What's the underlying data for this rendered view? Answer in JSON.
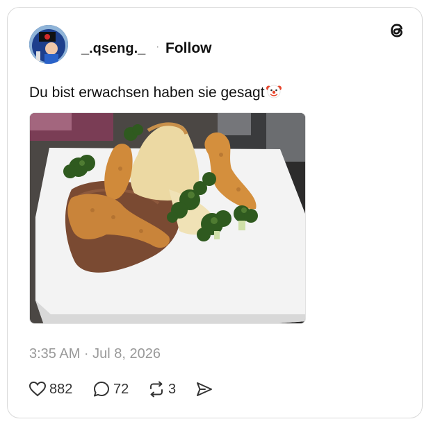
{
  "post": {
    "username": "_.qseng._",
    "separator": "·",
    "follow_label": "Follow",
    "text": "Du bist erwachsen haben sie gesagt",
    "text_emoji": "clown-face-emoji",
    "timestamp": "3:35 AM · Jul 8, 2026",
    "image_alt": "plate with dinosaur-shaped chicken nuggets, mashed potatoes, gravy and broccoli"
  },
  "actions": {
    "likes": "882",
    "replies": "72",
    "reposts": "3"
  },
  "icons": {
    "brand": "threads-logo-icon",
    "like": "heart-icon",
    "reply": "speech-bubble-icon",
    "repost": "repost-arrows-icon",
    "share": "send-icon"
  },
  "colors": {
    "text": "#111111",
    "muted": "#999999",
    "border": "#d9d9d9"
  }
}
